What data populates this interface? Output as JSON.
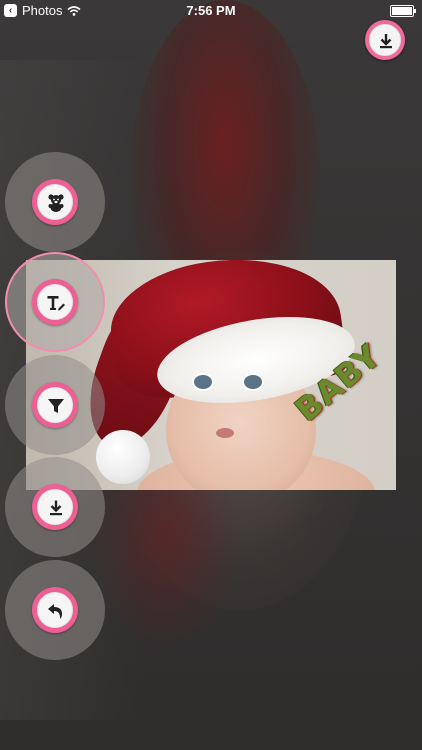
{
  "status_bar": {
    "back_label": "Photos",
    "time": "7:56 PM",
    "battery_percent": 100
  },
  "toolbar": {
    "top_save_icon": "download-icon",
    "tools": [
      {
        "name": "sticker",
        "icon": "teddy-bear-icon",
        "active": false
      },
      {
        "name": "text",
        "icon": "text-edit-icon",
        "active": true
      },
      {
        "name": "filter",
        "icon": "filter-icon",
        "active": false
      },
      {
        "name": "save",
        "icon": "download-icon",
        "active": false
      },
      {
        "name": "undo",
        "icon": "undo-icon",
        "active": false
      }
    ]
  },
  "photo": {
    "sticker_text": "BABY"
  },
  "colors": {
    "accent": "#ee5f93",
    "accent_light": "#f38db0",
    "background": "#3a3838"
  }
}
